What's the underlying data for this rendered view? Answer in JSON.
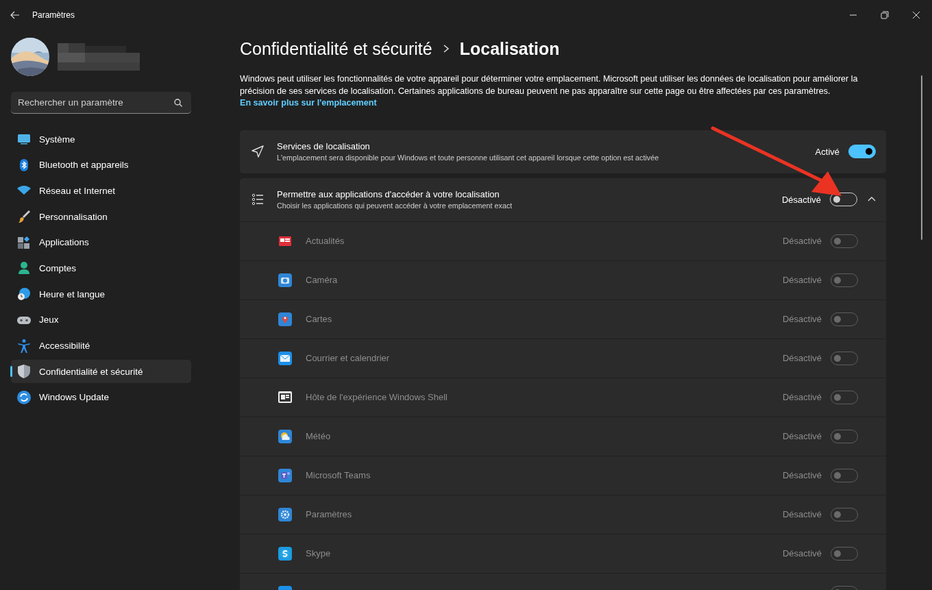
{
  "window": {
    "title": "Paramètres"
  },
  "search": {
    "placeholder": "Rechercher un paramètre"
  },
  "sidebar": {
    "items": [
      {
        "label": "Système",
        "selected": false
      },
      {
        "label": "Bluetooth et appareils",
        "selected": false
      },
      {
        "label": "Réseau et Internet",
        "selected": false
      },
      {
        "label": "Personnalisation",
        "selected": false
      },
      {
        "label": "Applications",
        "selected": false
      },
      {
        "label": "Comptes",
        "selected": false
      },
      {
        "label": "Heure et langue",
        "selected": false
      },
      {
        "label": "Jeux",
        "selected": false
      },
      {
        "label": "Accessibilité",
        "selected": false
      },
      {
        "label": "Confidentialité et sécurité",
        "selected": true
      },
      {
        "label": "Windows Update",
        "selected": false
      }
    ]
  },
  "breadcrumb": [
    "Confidentialité et sécurité",
    "Localisation"
  ],
  "description": {
    "text": "Windows peut utiliser les fonctionnalités de votre appareil pour déterminer votre emplacement. Microsoft peut utiliser les données de localisation pour améliorer la précision de ses services de localisation. Certaines applications de bureau peuvent ne pas apparaître sur cette page ou être affectées par ces paramètres.",
    "link": "En savoir plus sur l'emplacement"
  },
  "settings": [
    {
      "title": "Services de localisation",
      "subtitle": "L'emplacement sera disponible pour Windows et toute personne utilisant cet appareil lorsque cette option est activée",
      "status": "Activé",
      "on": true
    },
    {
      "title": "Permettre aux applications d'accéder à votre localisation",
      "subtitle": "Choisir les applications qui peuvent accéder à votre emplacement exact",
      "status": "Désactivé",
      "on": false,
      "expanded": true
    }
  ],
  "apps": [
    {
      "name": "Actualités",
      "status": "Désactivé",
      "on": false,
      "disabled": true
    },
    {
      "name": "Caméra",
      "status": "Désactivé",
      "on": false,
      "disabled": true
    },
    {
      "name": "Cartes",
      "status": "Désactivé",
      "on": false,
      "disabled": true
    },
    {
      "name": "Courrier et calendrier",
      "status": "Désactivé",
      "on": false,
      "disabled": true
    },
    {
      "name": "Hôte de l'expérience Windows Shell",
      "status": "Désactivé",
      "on": false,
      "disabled": true
    },
    {
      "name": "Météo",
      "status": "Désactivé",
      "on": false,
      "disabled": true
    },
    {
      "name": "Microsoft Teams",
      "status": "Désactivé",
      "on": false,
      "disabled": true
    },
    {
      "name": "Paramètres",
      "status": "Désactivé",
      "on": false,
      "disabled": true
    },
    {
      "name": "Skype",
      "status": "Désactivé",
      "on": false,
      "disabled": true
    },
    {
      "on": false,
      "disabled": true
    }
  ]
}
